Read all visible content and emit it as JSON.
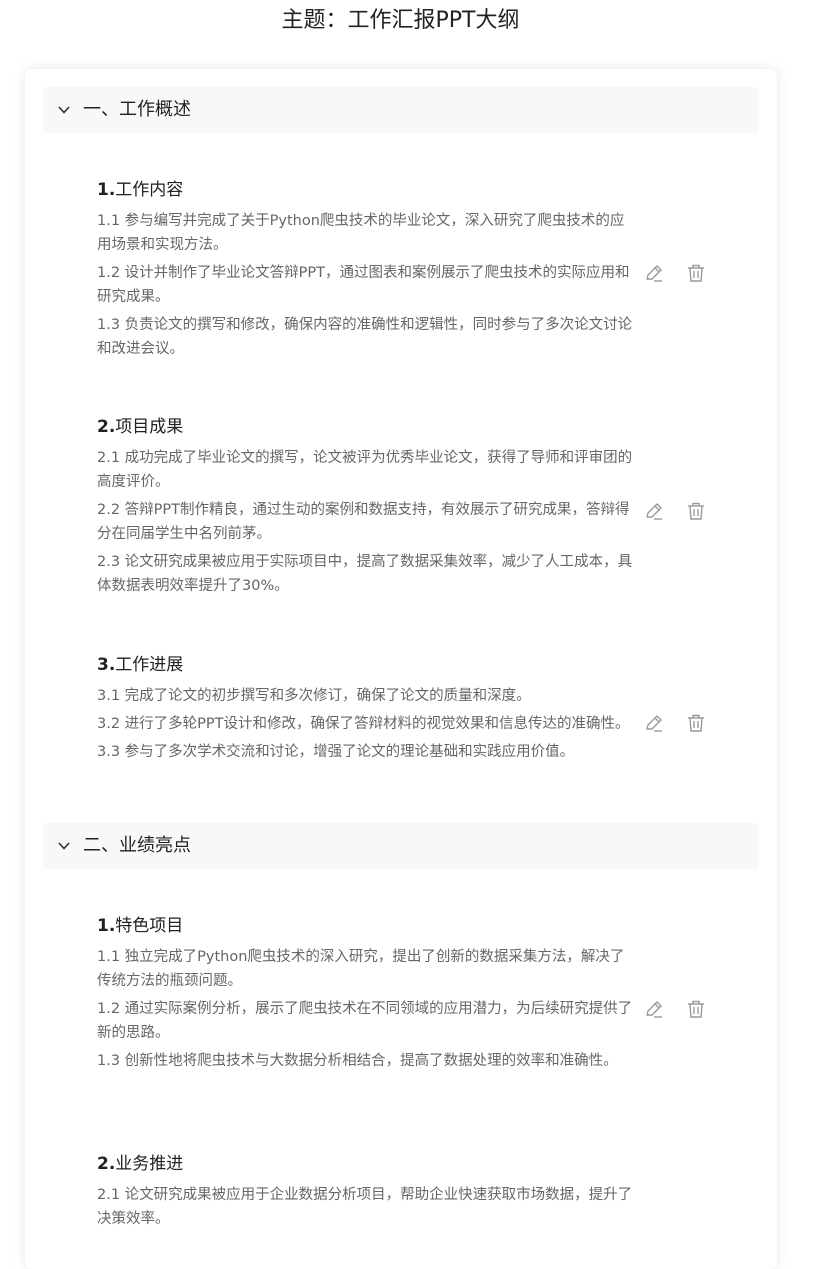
{
  "header": {
    "title": "主题：工作汇报PPT大纲"
  },
  "sections": [
    {
      "title": "一、工作概述",
      "items": [
        {
          "num": "1.",
          "title": "工作内容",
          "points": [
            "1.1 参与编写并完成了关于Python爬虫技术的毕业论文，深入研究了爬虫技术的应用场景和实现方法。",
            "1.2 设计并制作了毕业论文答辩PPT，通过图表和案例展示了爬虫技术的实际应用和研究成果。",
            "1.3 负责论文的撰写和修改，确保内容的准确性和逻辑性，同时参与了多次论文讨论和改进会议。"
          ]
        },
        {
          "num": "2.",
          "title": "项目成果",
          "points": [
            "2.1 成功完成了毕业论文的撰写，论文被评为优秀毕业论文，获得了导师和评审团的高度评价。",
            "2.2 答辩PPT制作精良，通过生动的案例和数据支持，有效展示了研究成果，答辩得分在同届学生中名列前茅。",
            "2.3 论文研究成果被应用于实际项目中，提高了数据采集效率，减少了人工成本，具体数据表明效率提升了30%。"
          ]
        },
        {
          "num": "3.",
          "title": "工作进展",
          "points": [
            "3.1 完成了论文的初步撰写和多次修订，确保了论文的质量和深度。",
            "3.2 进行了多轮PPT设计和修改，确保了答辩材料的视觉效果和信息传达的准确性。",
            "3.3 参与了多次学术交流和讨论，增强了论文的理论基础和实践应用价值。"
          ]
        }
      ]
    },
    {
      "title": "二、业绩亮点",
      "items": [
        {
          "num": "1.",
          "title": "特色项目",
          "points": [
            "1.1 独立完成了Python爬虫技术的深入研究，提出了创新的数据采集方法，解决了传统方法的瓶颈问题。",
            "1.2 通过实际案例分析，展示了爬虫技术在不同领域的应用潜力，为后续研究提供了新的思路。",
            "1.3 创新性地将爬虫技术与大数据分析相结合，提高了数据处理的效率和准确性。"
          ]
        },
        {
          "num": "2.",
          "title": "业务推进",
          "points": [
            "2.1 论文研究成果被应用于企业数据分析项目，帮助企业快速获取市场数据，提升了决策效率。"
          ]
        }
      ]
    }
  ],
  "icons": {
    "collapse": "chevron-down-icon",
    "edit": "pencil-icon",
    "delete": "trash-icon"
  },
  "colors": {
    "section_header_bg": "#f7f8fa",
    "icon_gray": "#999999",
    "text_secondary": "#666666"
  }
}
